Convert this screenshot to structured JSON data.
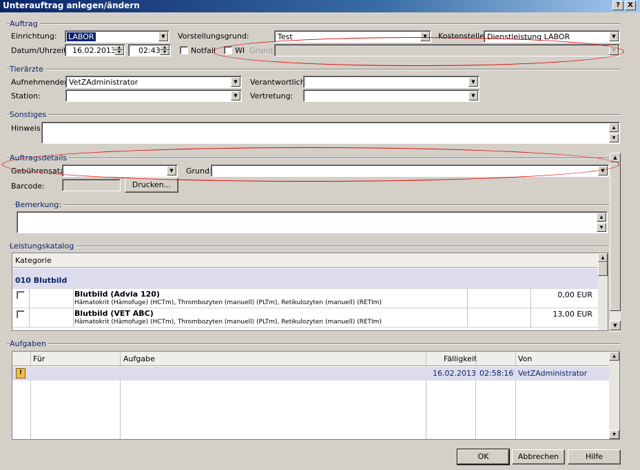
{
  "window": {
    "title": "Unterauftrag anlegen/ändern",
    "help_btn": "?",
    "close_btn": "X"
  },
  "auftrag": {
    "section": "Auftrag",
    "einrichtung_label": "Einrichtung:",
    "einrichtung_value": "LABOR",
    "vorstellungsgrund_label": "Vorstellungsgrund:",
    "vorstellungsgrund_value": "Test",
    "kostenstelle_label": "Kostenstelle:",
    "kostenstelle_value": "Dienstleistung LABOR",
    "datum_label": "Datum/Uhrzeit:",
    "datum_value": "16.02.2013",
    "uhrzeit_value": "02:43",
    "notfall_label": "Notfall",
    "wi_label": "WI",
    "grund_label": "Grund:"
  },
  "tieraerzte": {
    "section": "Tierärzte",
    "aufnehmender_label": "Aufnehmender:",
    "aufnehmender_value": "VetZAdministrator",
    "verantwortlich_label": "Verantwortlich:",
    "station_label": "Station:",
    "vertretung_label": "Vertretung:"
  },
  "sonstiges": {
    "section": "Sonstiges",
    "hinweis_label": "Hinweis:"
  },
  "auftragsdetails": {
    "section": "Auftragsdetails",
    "gebuehrensatz_label": "Gebührensatz:",
    "grund_label": "Grund:",
    "barcode_label": "Barcode:",
    "drucken_btn": "Drucken...",
    "bemerkung_label": "Bemerkung:"
  },
  "leistungskatalog": {
    "section": "Leistungskatalog",
    "col_kategorie": "Kategorie",
    "group": "010 Blutbild",
    "rows": [
      {
        "name": "Blutbild (Advia 120)",
        "desc": "Hämatokrit (Hämofuge) (HCTm), Thrombozyten (manuell) (PLTm), Retikulozyten (manuell) (RETIm)",
        "price": "0,00 EUR"
      },
      {
        "name": "Blutbild (VET ABC)",
        "desc": "Hämatokrit (Hämofuge) (HCTm), Thrombozyten (manuell) (PLTm), Retikulozyten (manuell) (RETIm)",
        "price": "13,00 EUR"
      }
    ]
  },
  "aufgaben": {
    "section": "Aufgaben",
    "cols": {
      "fuer": "Für",
      "aufgabe": "Aufgabe",
      "faelligkeit": "Fälligkeit",
      "von": "Von"
    },
    "row": {
      "date": "16.02.2013",
      "time": "02:58:16",
      "von": "VetZAdministrator"
    }
  },
  "buttons": {
    "ok": "OK",
    "abbrechen": "Abbrechen",
    "hilfe": "Hilfe"
  },
  "colors": {
    "annotation": "#e00000",
    "selection": "#0a246a",
    "link_text": "#0a246a"
  }
}
